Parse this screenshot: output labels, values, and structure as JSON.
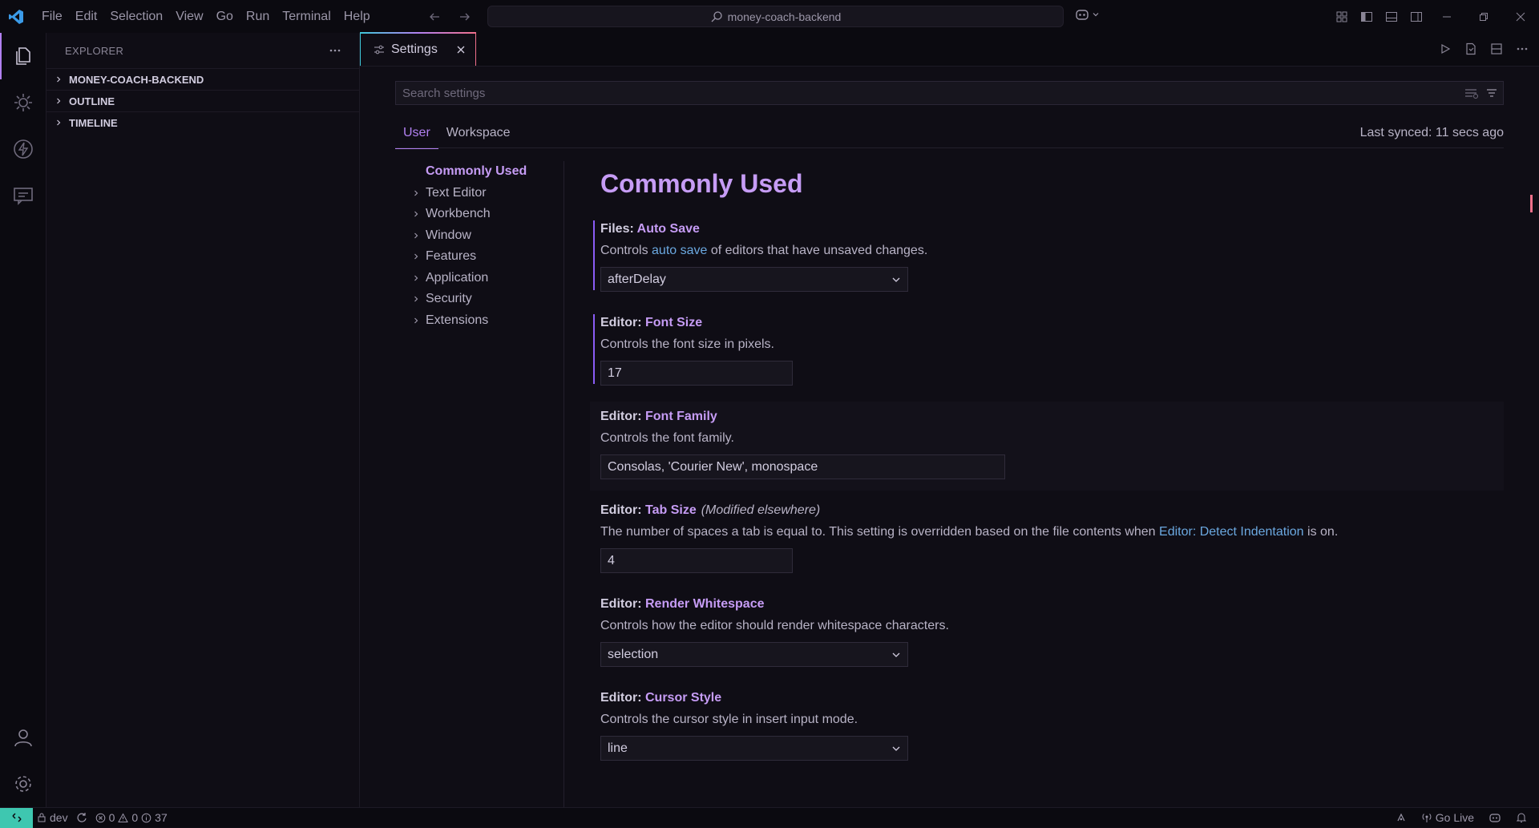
{
  "titlebar": {
    "menu": [
      "File",
      "Edit",
      "Selection",
      "View",
      "Go",
      "Run",
      "Terminal",
      "Help"
    ],
    "search_text": "money-coach-backend"
  },
  "sidebar": {
    "title": "EXPLORER",
    "sections": [
      "MONEY-COACH-BACKEND",
      "OUTLINE",
      "TIMELINE"
    ]
  },
  "editor": {
    "tab_label": "Settings"
  },
  "settings": {
    "search_placeholder": "Search settings",
    "scope_tabs": [
      "User",
      "Workspace"
    ],
    "last_synced": "Last synced: 11 secs ago",
    "toc": {
      "active": "Commonly Used",
      "items": [
        "Text Editor",
        "Workbench",
        "Window",
        "Features",
        "Application",
        "Security",
        "Extensions"
      ]
    },
    "section_title": "Commonly Used",
    "items": [
      {
        "category": "Files: ",
        "name": "Auto Save",
        "desc_before": "Controls ",
        "desc_link": "auto save",
        "desc_after": " of editors that have unsaved changes.",
        "value": "afterDelay"
      },
      {
        "category": "Editor: ",
        "name": "Font Size",
        "desc": "Controls the font size in pixels.",
        "value": "17"
      },
      {
        "category": "Editor: ",
        "name": "Font Family",
        "desc": "Controls the font family.",
        "value": "Consolas, 'Courier New', monospace"
      },
      {
        "category": "Editor: ",
        "name": "Tab Size",
        "modified": "(Modified elsewhere)",
        "desc_before": "The number of spaces a tab is equal to. This setting is overridden based on the file contents when ",
        "desc_link": "Editor: Detect Indentation",
        "desc_after": " is on.",
        "value": "4"
      },
      {
        "category": "Editor: ",
        "name": "Render Whitespace",
        "desc": "Controls how the editor should render whitespace characters.",
        "value": "selection"
      },
      {
        "category": "Editor: ",
        "name": "Cursor Style",
        "desc": "Controls the cursor style in insert input mode.",
        "value": "line"
      }
    ]
  },
  "statusbar": {
    "branch": "dev",
    "errors": "0",
    "warnings": "0",
    "infos": "37",
    "go_live": "Go Live"
  },
  "colors": {
    "accent": "#b180f0",
    "link": "#6ba8e0",
    "remote": "#3ec7b0",
    "tab_gradient_start": "#3ec7d8",
    "tab_gradient_end": "#f0708a"
  },
  "icons": [
    "vscode-logo-icon",
    "search-icon",
    "copilot-icon",
    "explorer-icon",
    "extensions-icon",
    "lightning-icon",
    "chat-icon",
    "account-icon",
    "gear-icon",
    "settings-icon",
    "close-icon",
    "run-icon",
    "filter-icon",
    "chevron-right-icon",
    "chevron-down-icon",
    "remote-icon",
    "lock-icon",
    "sync-icon",
    "error-icon",
    "warning-icon",
    "info-icon",
    "broadcast-icon",
    "bell-icon"
  ]
}
